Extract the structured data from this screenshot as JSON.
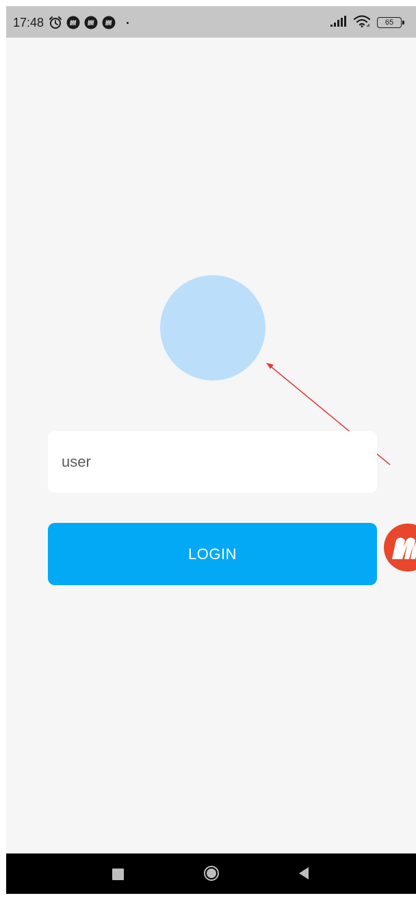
{
  "status_bar": {
    "time": "17:48",
    "battery_level": "65",
    "icons": [
      "alarm-icon",
      "m-app-notification-icon",
      "m-app-notification-icon",
      "m-app-notification-icon",
      "dot-icon",
      "signal-icon",
      "wifi-icon",
      "battery-icon"
    ]
  },
  "login": {
    "username_value": "user",
    "username_placeholder": "",
    "login_label": "LOGIN"
  },
  "floating_bubble": {
    "icon": "m-app-logo-icon"
  },
  "nav_bar": {
    "icons": [
      "recents-icon",
      "home-icon",
      "back-icon"
    ]
  },
  "colors": {
    "background": "#f6f6f6",
    "status_bar": "#c6c6c6",
    "avatar": "#bbdefb",
    "primary_button": "#03a9f4",
    "annotation_arrow": "#e53935",
    "bubble": "#e8472b",
    "nav_bar": "#000000"
  }
}
